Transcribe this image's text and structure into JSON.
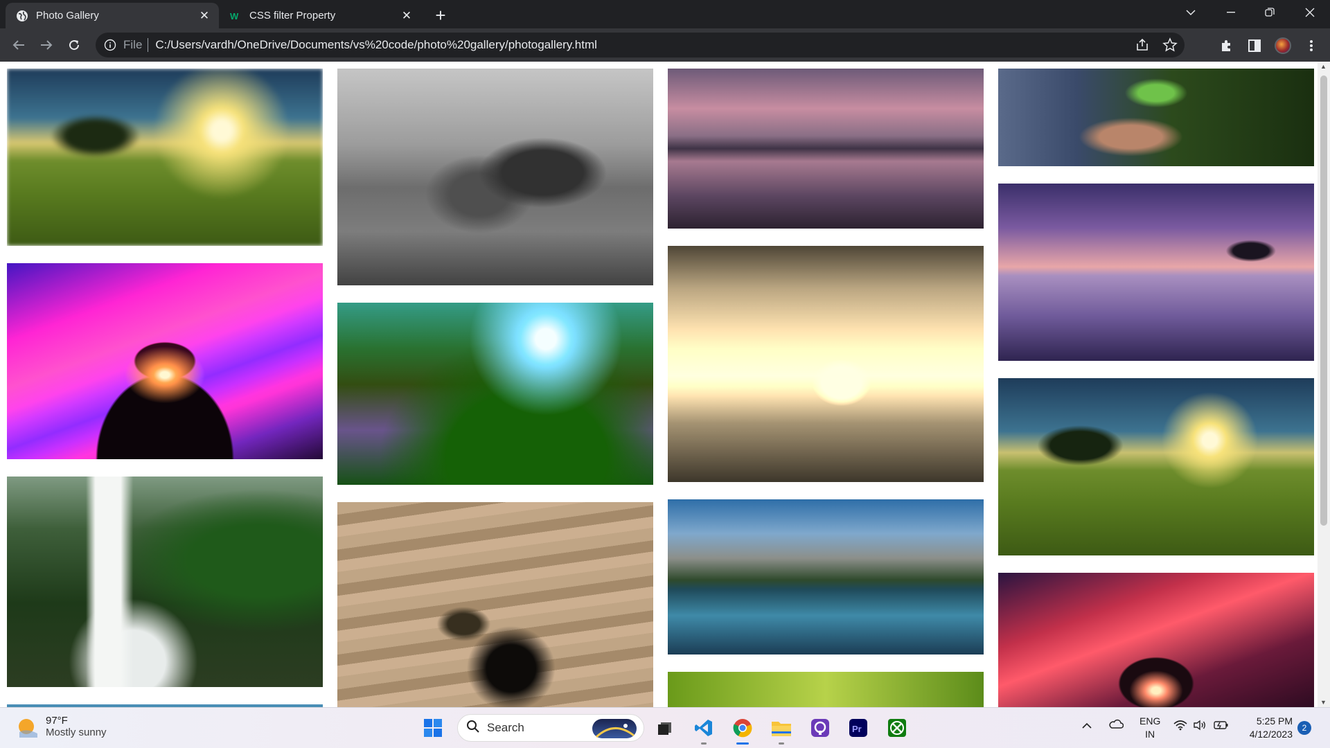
{
  "browser": {
    "tabs": [
      {
        "title": "Photo Gallery",
        "favicon": "globe-icon",
        "active": true
      },
      {
        "title": "CSS filter Property",
        "favicon": "w3schools-icon",
        "active": false
      }
    ],
    "address": {
      "scheme_label": "File",
      "url": "C:/Users/vardh/OneDrive/Documents/vs%20code/photo%20gallery/photogallery.html"
    },
    "toolbar_icons": [
      "back-icon",
      "forward-icon",
      "reload-icon",
      "share-icon",
      "star-icon",
      "extensions-icon",
      "side-panel-icon",
      "profile-avatar",
      "menu-icon"
    ]
  },
  "gallery": {
    "columns": [
      [
        {
          "name": "meadow-tree-sunset",
          "filter": "blur"
        },
        {
          "name": "pink-sky-tree",
          "filter": "saturate"
        },
        {
          "name": "forest-waterfall",
          "filter": "none"
        },
        {
          "name": "partial-bottom",
          "filter": "none"
        }
      ],
      [
        {
          "name": "mountain-rainbow",
          "filter": "grayscale"
        },
        {
          "name": "sunrise-flower-hills",
          "filter": "hue-rotate"
        },
        {
          "name": "black-swan",
          "filter": "invert"
        }
      ],
      [
        {
          "name": "lake-tree-dusk",
          "filter": "none"
        },
        {
          "name": "canoe-reflection",
          "filter": "sepia"
        },
        {
          "name": "mountain-lake",
          "filter": "none"
        },
        {
          "name": "green-bokeh",
          "filter": "none"
        }
      ],
      [
        {
          "name": "hand-seedling",
          "filter": "none"
        },
        {
          "name": "purple-lake-tree",
          "filter": "none"
        },
        {
          "name": "meadow-tree-sunset-2",
          "filter": "none"
        },
        {
          "name": "red-sky-tree",
          "filter": "none"
        }
      ]
    ]
  },
  "taskbar": {
    "weather": {
      "temp": "97°F",
      "condition": "Mostly sunny"
    },
    "search_label": "Search",
    "apps": [
      "start-icon",
      "search-box",
      "task-view-icon",
      "vscode-icon",
      "chrome-icon",
      "file-explorer-icon",
      "app-icon",
      "premiere-pro-icon",
      "xbox-icon"
    ],
    "tray": {
      "lang_line1": "ENG",
      "lang_line2": "IN",
      "time": "5:25 PM",
      "date": "4/12/2023",
      "notifications": "2"
    }
  },
  "colors": {
    "tabstrip": "#202124",
    "toolbar": "#35363a",
    "accent": "#1a73e8"
  }
}
